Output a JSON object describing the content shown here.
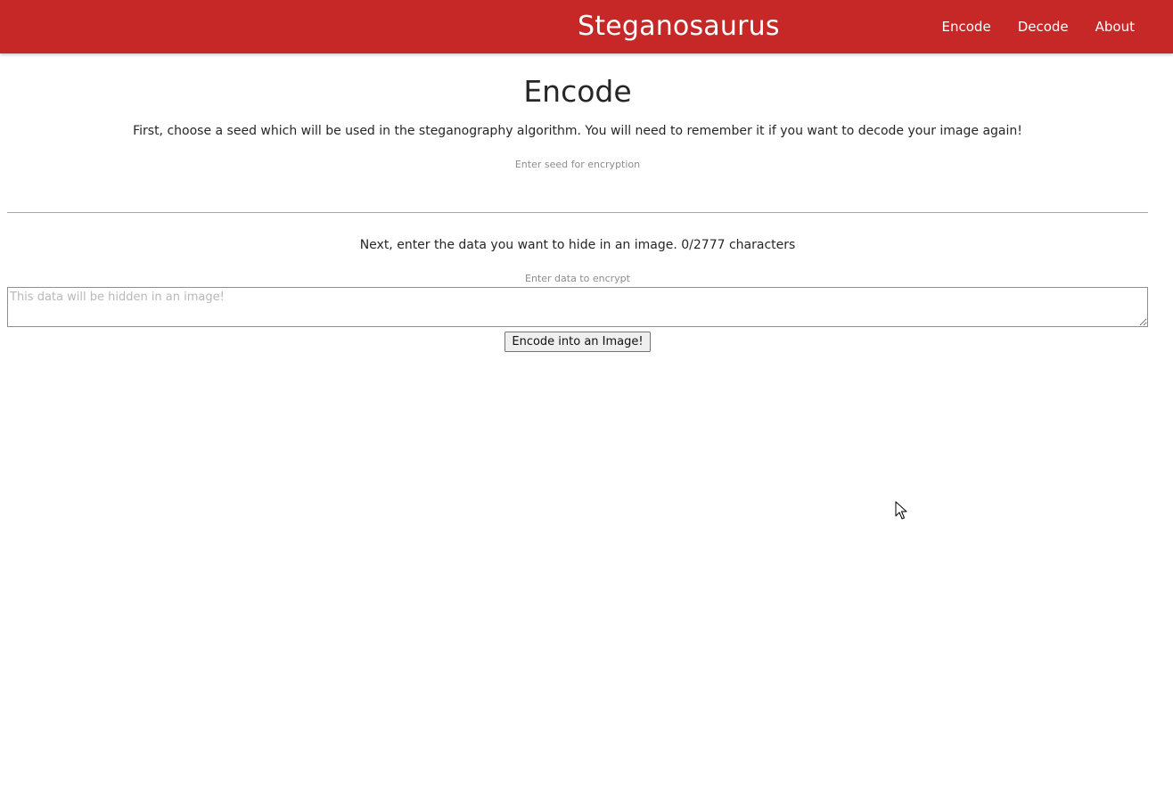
{
  "navbar": {
    "brand": "Steganosaurus",
    "links": [
      {
        "label": "Encode"
      },
      {
        "label": "Decode"
      },
      {
        "label": "About"
      }
    ],
    "background_color": "#c62828"
  },
  "page": {
    "title": "Encode",
    "seed_instruction": "First, choose a seed which will be used in the steganography algorithm. You will need to remember it if you want to decode your image again!",
    "seed_label": "Enter seed for encryption",
    "seed_value": "",
    "data_instruction": "Next, enter the data you want to hide in an image. 0/2777 characters",
    "data_label": "Enter data to encrypt",
    "data_placeholder": "This data will be hidden in an image!",
    "data_value": "",
    "encode_button": "Encode into an Image!"
  },
  "icons": {
    "mouse_cursor": "arrow-pointer-icon"
  }
}
